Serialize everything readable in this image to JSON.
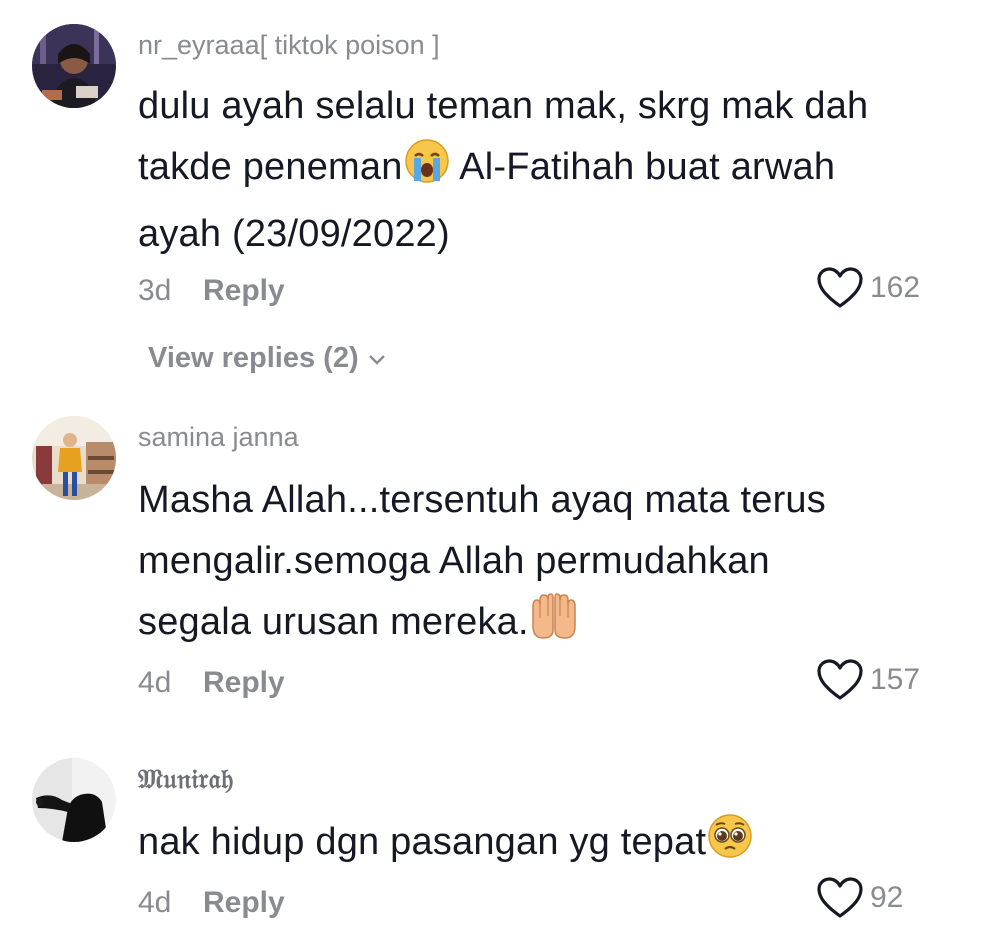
{
  "comments": [
    {
      "username": "nr_eyraaa[ tiktok poison ]",
      "text_line1": "dulu ayah selalu teman mak, skrg mak dah",
      "text_line2a": "takde peneman",
      "text_line2b": " Al-Fatihah buat arwah",
      "text_line3": "ayah (23/09/2022)",
      "emoji": "crying-face-emoji",
      "time": "3d",
      "reply_label": "Reply",
      "likes": "162",
      "view_replies": "View replies (2)"
    },
    {
      "username": "samina janna",
      "text_line1": "Masha Allah...tersentuh ayaq mata terus",
      "text_line2": "mengalir.semoga Allah permudahkan",
      "text_line3": "segala urusan mereka.",
      "emoji": "palms-up-emoji",
      "time": "4d",
      "reply_label": "Reply",
      "likes": "157"
    },
    {
      "username": "𝔐𝔲𝔫𝔦𝔯𝔞𝔥",
      "text_line1": "nak hidup dgn pasangan yg tepat",
      "emoji": "pleading-face-emoji",
      "time": "4d",
      "reply_label": "Reply",
      "likes": "92"
    }
  ],
  "colors": {
    "text": "#161823",
    "muted": "#8a8b91",
    "background": "#ffffff"
  }
}
